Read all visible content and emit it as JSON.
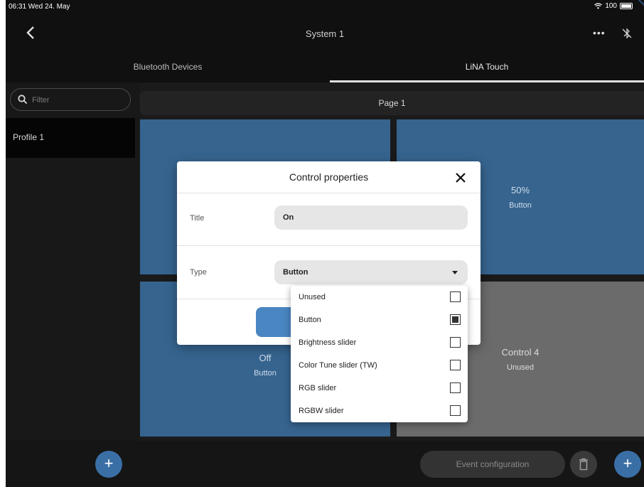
{
  "status_bar": {
    "time_date": "06:31  Wed 24. May",
    "battery": "100"
  },
  "nav": {
    "title": "System 1",
    "more": "•••"
  },
  "tabs": [
    {
      "label": "Bluetooth Devices"
    },
    {
      "label": "LiNA Touch"
    }
  ],
  "sidebar": {
    "filter_placeholder": "Filter",
    "profiles": [
      {
        "label": "Profile 1"
      }
    ]
  },
  "page": {
    "title": "Page 1"
  },
  "controls": [
    {
      "name": "",
      "type": ""
    },
    {
      "name": "50%",
      "type": "Button"
    },
    {
      "name": "Off",
      "type": "Button"
    },
    {
      "name": "Control 4",
      "type": "Unused"
    }
  ],
  "bottom": {
    "event_config_label": "Event configuration",
    "add_symbol": "+"
  },
  "dialog": {
    "title": "Control properties",
    "title_label": "Title",
    "title_value": "On",
    "type_label": "Type",
    "type_value": "Button"
  },
  "type_options": [
    {
      "label": "Unused",
      "checked": false
    },
    {
      "label": "Button",
      "checked": true
    },
    {
      "label": "Brightness slider",
      "checked": false
    },
    {
      "label": "Color Tune slider (TW)",
      "checked": false
    },
    {
      "label": "RGB slider",
      "checked": false
    },
    {
      "label": "RGBW slider",
      "checked": false
    }
  ],
  "colors": {
    "control_active": "#36648f",
    "control_unused": "#6b6b6b",
    "accent": "#3a6fa6"
  }
}
